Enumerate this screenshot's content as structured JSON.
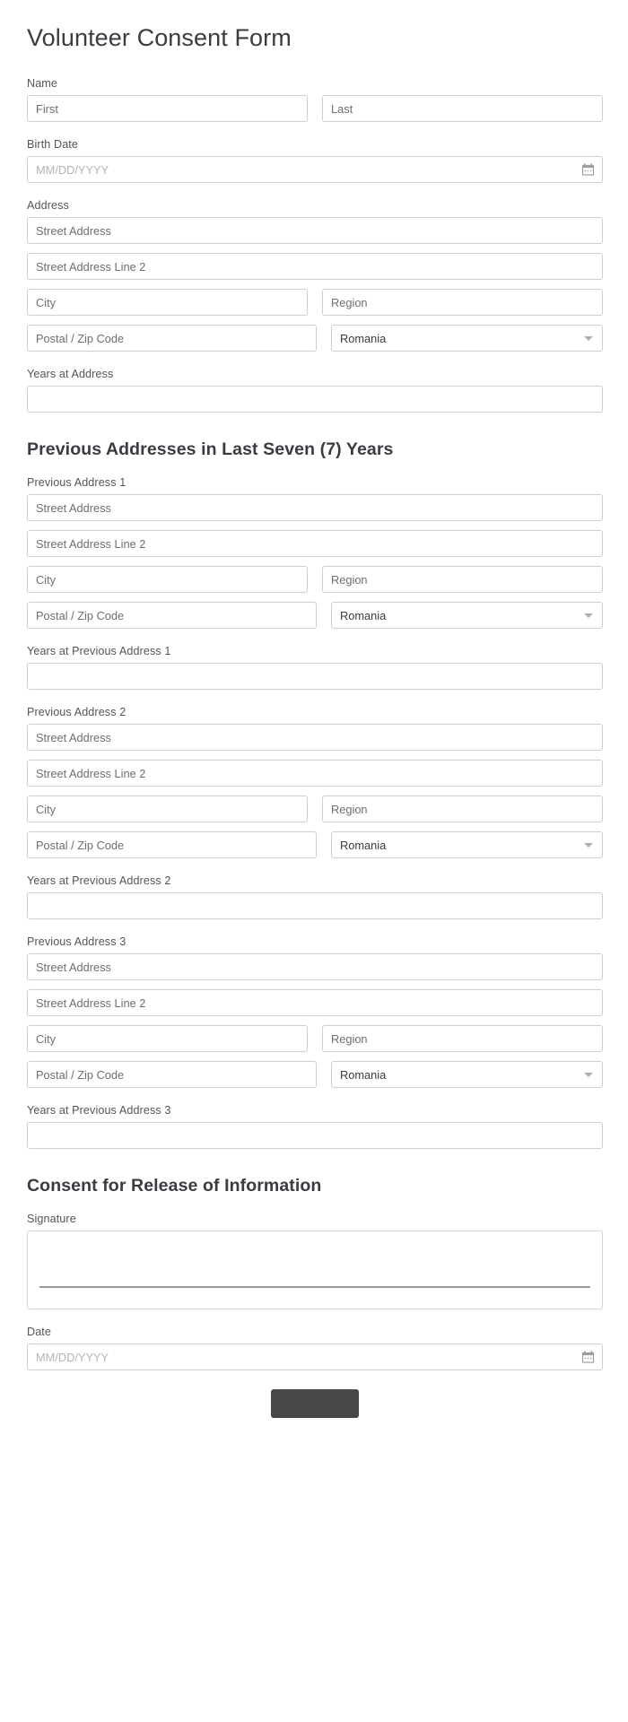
{
  "form": {
    "title": "Volunteer Consent Form",
    "name_section": {
      "label": "Name",
      "first_placeholder": "First",
      "last_placeholder": "Last"
    },
    "birth_date": {
      "label": "Birth Date",
      "placeholder": "MM/DD/YYYY",
      "icon": "calendar-icon"
    },
    "address": {
      "label": "Address",
      "street_placeholder": "Street Address",
      "street2_placeholder": "Street Address Line 2",
      "city_placeholder": "City",
      "region_placeholder": "Region",
      "postal_placeholder": "Postal / Zip Code",
      "country_value": "Romania",
      "country_caret": "chevron-down-icon"
    },
    "years_at_address": {
      "label": "Years at Address",
      "value": ""
    },
    "previous_section": {
      "heading": "Previous Addresses in Last Seven (7) Years",
      "entries": [
        {
          "label": "Previous Address 1",
          "street_placeholder": "Street Address",
          "street2_placeholder": "Street Address Line 2",
          "city_placeholder": "City",
          "region_placeholder": "Region",
          "postal_placeholder": "Postal / Zip Code",
          "country_value": "Romania",
          "years_label": "Years at Previous Address 1",
          "years_value": ""
        },
        {
          "label": "Previous Address 2",
          "street_placeholder": "Street Address",
          "street2_placeholder": "Street Address Line 2",
          "city_placeholder": "City",
          "region_placeholder": "Region",
          "postal_placeholder": "Postal / Zip Code",
          "country_value": "Romania",
          "years_label": "Years at Previous Address 2",
          "years_value": ""
        },
        {
          "label": "Previous Address 3",
          "street_placeholder": "Street Address",
          "street2_placeholder": "Street Address Line 2",
          "city_placeholder": "City",
          "region_placeholder": "Region",
          "postal_placeholder": "Postal / Zip Code",
          "country_value": "Romania",
          "years_label": "Years at Previous Address 3",
          "years_value": ""
        }
      ]
    },
    "consent_section": {
      "heading": "Consent for Release of Information",
      "signature_label": "Signature",
      "signature_value": "",
      "date_label": "Date",
      "date_placeholder": "MM/DD/YYYY",
      "date_icon": "calendar-icon"
    },
    "submit": {
      "label": ""
    }
  },
  "colors": {
    "text": "#3b3b42",
    "label": "#555558",
    "border": "#cfcfcf",
    "placeholder": "#6e6e73",
    "placeholder_light": "#b4b4b8",
    "submit_bg": "#474749",
    "signature_line": "#9a9a9e"
  }
}
